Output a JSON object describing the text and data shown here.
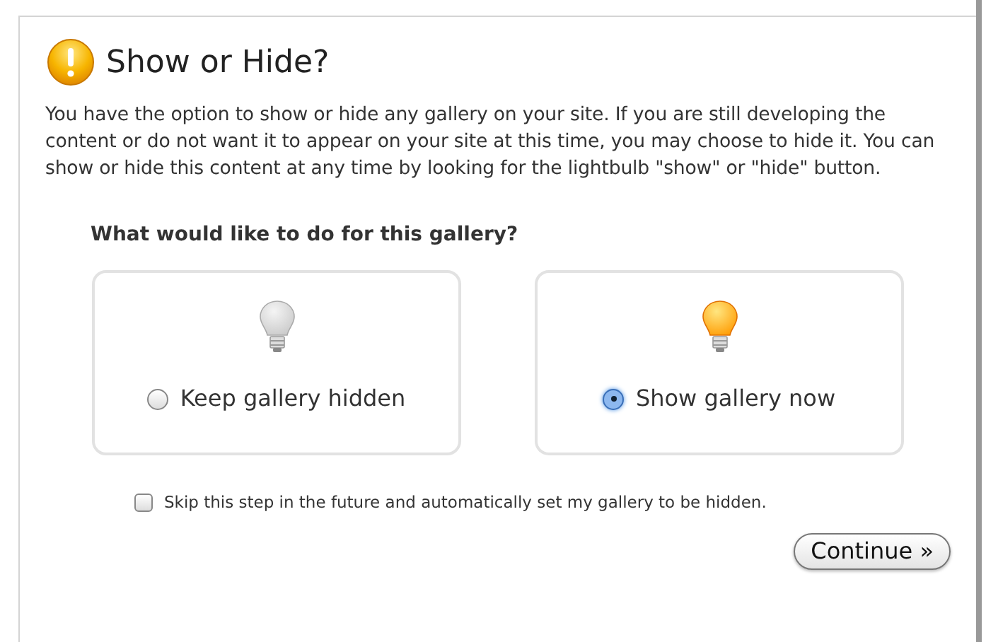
{
  "dialog": {
    "title": "Show or Hide?",
    "description": "You have the option to show or hide any gallery on your site. If you are still developing the content or do not want it to appear on your site at this time, you may choose to hide it. You can show or hide this content at any time by looking for the lightbulb \"show\" or \"hide\" button.",
    "question": "What would like to do for this gallery?",
    "options": [
      {
        "label": "Keep gallery hidden",
        "kind": "off",
        "selected": false
      },
      {
        "label": "Show gallery now",
        "kind": "on",
        "selected": true
      }
    ],
    "skip": {
      "label": "Skip this step in the future and automatically set my gallery to be hidden.",
      "checked": false
    },
    "button": "Continue »"
  }
}
